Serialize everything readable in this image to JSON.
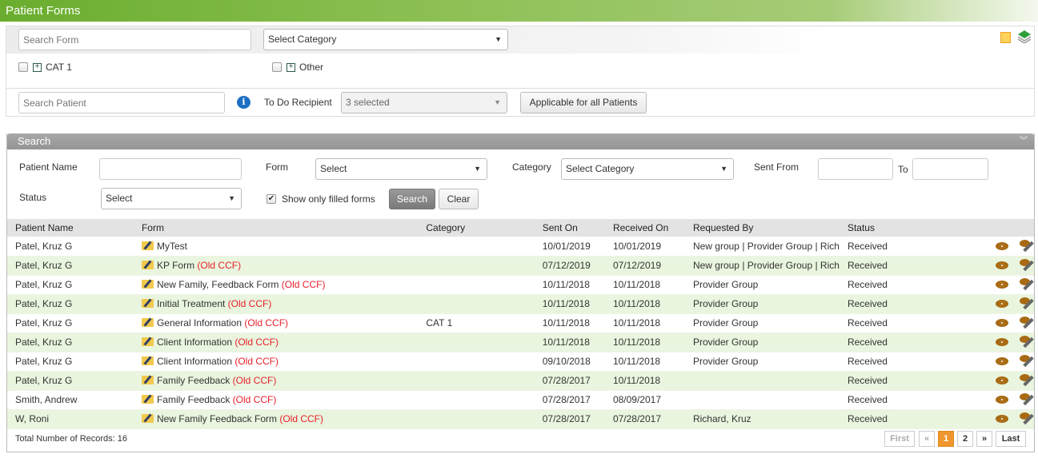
{
  "page": {
    "title": "Patient Forms"
  },
  "top_panel": {
    "search_form_placeholder": "Search Form",
    "category_select": "Select Category",
    "categories": [
      {
        "label": "CAT 1",
        "checked": false
      },
      {
        "label": "Other",
        "checked": false
      }
    ],
    "search_patient_placeholder": "Search Patient",
    "todo_recipient_label": "To Do Recipient",
    "todo_recipient_value": "3 selected",
    "applicable_button": "Applicable for all Patients"
  },
  "search_panel": {
    "title": "Search",
    "patient_name_label": "Patient Name",
    "patient_name_value": "",
    "form_label": "Form",
    "form_select": "Select",
    "category_label": "Category",
    "category_select": "Select Category",
    "sent_from_label": "Sent From",
    "sent_from_value": "",
    "to_label": "To",
    "to_value": "",
    "status_label": "Status",
    "status_select": "Select",
    "show_filled_label": "Show only filled forms",
    "show_filled_checked": true,
    "search_button": "Search",
    "clear_button": "Clear"
  },
  "table": {
    "columns": [
      "Patient Name",
      "Form",
      "Category",
      "Sent On",
      "Received On",
      "Requested By",
      "Status"
    ],
    "rows": [
      {
        "patient": "Patel, Kruz G",
        "form": "MyTest",
        "tag": "",
        "category": "",
        "sent": "10/01/2019",
        "received": "10/01/2019",
        "requested_by": "New group | Provider Group | Rich",
        "status": "Received"
      },
      {
        "patient": "Patel, Kruz G",
        "form": "KP Form",
        "tag": "(Old CCF)",
        "category": "",
        "sent": "07/12/2019",
        "received": "07/12/2019",
        "requested_by": "New group | Provider Group | Rich",
        "status": "Received"
      },
      {
        "patient": "Patel, Kruz G",
        "form": "New Family, Feedback Form",
        "tag": "(Old CCF)",
        "category": "",
        "sent": "10/11/2018",
        "received": "10/11/2018",
        "requested_by": "Provider Group",
        "status": "Received"
      },
      {
        "patient": "Patel, Kruz G",
        "form": "Initial Treatment",
        "tag": "(Old CCF)",
        "category": "",
        "sent": "10/11/2018",
        "received": "10/11/2018",
        "requested_by": "Provider Group",
        "status": "Received"
      },
      {
        "patient": "Patel, Kruz G",
        "form": "General Information",
        "tag": "(Old CCF)",
        "category": "CAT 1",
        "sent": "10/11/2018",
        "received": "10/11/2018",
        "requested_by": "Provider Group",
        "status": "Received"
      },
      {
        "patient": "Patel, Kruz G",
        "form": "Client Information",
        "tag": "(Old CCF)",
        "category": "",
        "sent": "10/11/2018",
        "received": "10/11/2018",
        "requested_by": "Provider Group",
        "status": "Received"
      },
      {
        "patient": "Patel, Kruz G",
        "form": "Client Information",
        "tag": "(Old CCF)",
        "category": "",
        "sent": "09/10/2018",
        "received": "10/11/2018",
        "requested_by": "Provider Group",
        "status": "Received"
      },
      {
        "patient": "Patel, Kruz G",
        "form": "Family Feedback",
        "tag": "(Old CCF)",
        "category": "",
        "sent": "07/28/2017",
        "received": "10/11/2018",
        "requested_by": "",
        "status": "Received"
      },
      {
        "patient": "Smith, Andrew",
        "form": "Family Feedback",
        "tag": "(Old CCF)",
        "category": "",
        "sent": "07/28/2017",
        "received": "08/09/2017",
        "requested_by": "",
        "status": "Received"
      },
      {
        "patient": "W, Roni",
        "form": "New Family Feedback Form",
        "tag": "(Old CCF)",
        "category": "",
        "sent": "07/28/2017",
        "received": "07/28/2017",
        "requested_by": "Richard, Kruz",
        "status": "Received"
      }
    ]
  },
  "footer": {
    "total_records": "Total Number of Records: 16",
    "pager": {
      "first": "First",
      "prev": "«",
      "pages": [
        "1",
        "2"
      ],
      "current": "1",
      "next": "»",
      "last": "Last"
    }
  },
  "colors": {
    "brand_green": "#6aad2e",
    "old_ccf_red": "#e8202a",
    "pager_active": "#f0962e",
    "row_alt": "#e9f5de"
  }
}
